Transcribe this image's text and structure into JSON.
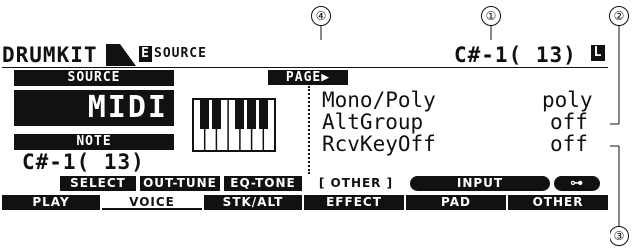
{
  "callouts": [
    "④",
    "①",
    "②",
    "③"
  ],
  "header": {
    "mode": "DRUMKIT",
    "edit_badge": "E",
    "section": "SOURCE",
    "note": "C#-1( 13)",
    "lock_badge": "L"
  },
  "left_panel": {
    "source_label": "SOURCE",
    "source_value": "MIDI",
    "note_label": "NOTE",
    "note_value": "C#-1( 13)"
  },
  "page_label": "PAGE",
  "params": [
    {
      "label": "Mono/Poly",
      "value": "poly"
    },
    {
      "label": "AltGroup",
      "value": "off"
    },
    {
      "label": "RcvKeyOff",
      "value": "off"
    }
  ],
  "function_buttons": [
    {
      "label": "SELECT",
      "style": "inverse"
    },
    {
      "label": "OUT-TUNE",
      "style": "inverse"
    },
    {
      "label": "EQ-TONE",
      "style": "inverse"
    },
    {
      "label": "[ OTHER ]",
      "style": "selected"
    },
    {
      "label": "INPUT",
      "style": "pill"
    },
    {
      "label": "⊶",
      "style": "pill-icon"
    }
  ],
  "tabs": [
    {
      "label": "PLAY"
    },
    {
      "label": "VOICE",
      "active": true
    },
    {
      "label": "STK/ALT"
    },
    {
      "label": "EFFECT"
    },
    {
      "label": "PAD"
    },
    {
      "label": "OTHER"
    }
  ]
}
